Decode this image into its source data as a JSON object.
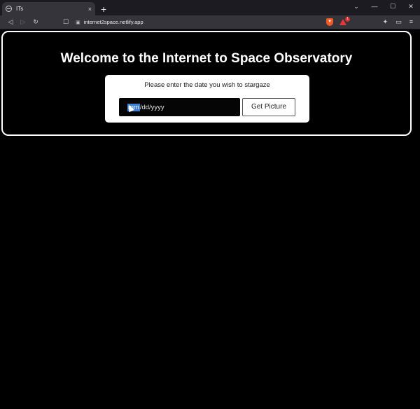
{
  "browser": {
    "tab": {
      "title": "ITs",
      "favicon": "globe-icon",
      "close": "×"
    },
    "new_tab_label": "+",
    "window_controls": {
      "dropdown": "⌄",
      "minimize": "—",
      "maximize": "☐",
      "close": "✕"
    },
    "nav": {
      "back": "◁",
      "forward": "▷",
      "reload": "↻"
    },
    "address": {
      "url": "internet2space.netlify.app",
      "lock": "🔒"
    },
    "rewards_badge": "1",
    "toolbar_icons": [
      "puzzle-icon",
      "wallet-icon",
      "menu-icon"
    ]
  },
  "page": {
    "title": "Welcome to the Internet to Space Observatory",
    "card": {
      "prompt": "Please enter the date you wish to stargaze",
      "date_input": {
        "selected_part": "mm",
        "rest": "/dd/yyyy"
      },
      "button_label": "Get Picture"
    }
  },
  "colors": {
    "page_bg": "#000000",
    "chrome_bg": "#35343a",
    "tabbar_bg": "#1c1b22",
    "selection": "#3b7fd1",
    "brave_orange": "#f05a24"
  }
}
